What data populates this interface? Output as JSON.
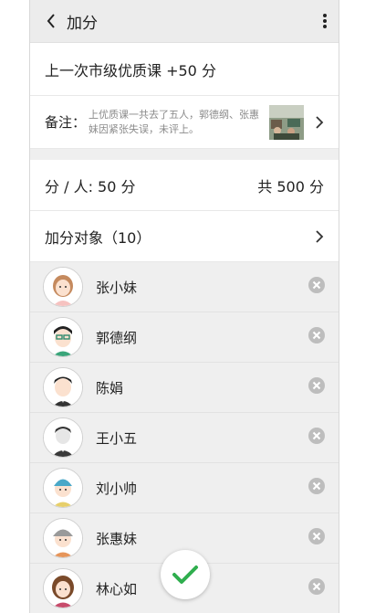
{
  "header": {
    "title": "加分"
  },
  "record": {
    "title": "上一次市级优质课 +50 分",
    "remark_label": "备注：",
    "remark_text": "上优质课一共去了五人，郭德纲、张惠妹因紧张失误，未评上。"
  },
  "score": {
    "per_person": "分 / 人:  50  分",
    "total": "共 500 分"
  },
  "targets": {
    "label": "加分对象（10）"
  },
  "people": [
    {
      "name": "张小妹"
    },
    {
      "name": "郭德纲"
    },
    {
      "name": "陈娟"
    },
    {
      "name": "王小五"
    },
    {
      "name": "刘小帅"
    },
    {
      "name": "张惠妹"
    },
    {
      "name": "林心如"
    }
  ],
  "colors": {
    "accent_green": "#2fae4e",
    "remove_gray": "#bdbdbd"
  }
}
